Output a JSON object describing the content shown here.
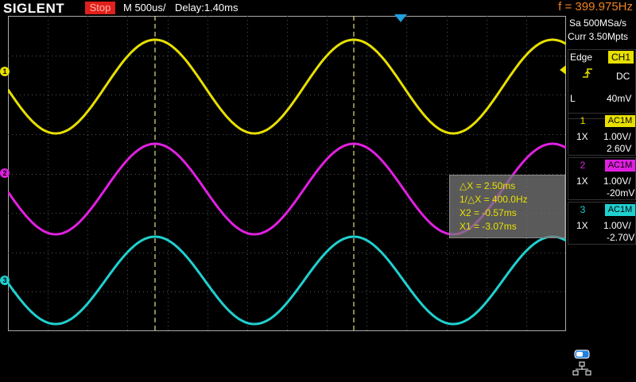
{
  "header": {
    "brand": "SIGLENT",
    "status": "Stop",
    "timebase": "M 500us/",
    "delay": "Delay:1.40ms",
    "frequency": "f = 399.975Hz"
  },
  "acquisition": {
    "sample_rate": "Sa 500MSa/s",
    "memory": "Curr 3.50Mpts"
  },
  "trigger": {
    "type": "Edge",
    "source": "CH1",
    "slope_icon": "rising-edge-icon",
    "coupling": "DC",
    "level_label": "L",
    "level": "40mV"
  },
  "channels": [
    {
      "num": "1",
      "probe": "1X",
      "coupling": "AC1M",
      "scale": "1.00V/",
      "offset": "2.60V",
      "color": "#e8e000"
    },
    {
      "num": "2",
      "probe": "1X",
      "coupling": "AC1M",
      "scale": "1.00V/",
      "offset": "-20mV",
      "color": "#e020e0"
    },
    {
      "num": "3",
      "probe": "1X",
      "coupling": "AC1M",
      "scale": "1.00V/",
      "offset": "-2.70V",
      "color": "#20d0d0"
    }
  ],
  "cursor_measurements": {
    "delta_x": "△X = 2.50ms",
    "inv_delta_x": "1/△X = 400.0Hz",
    "x2": "X2 = -0.57ms",
    "x1": "X1 = -3.07ms"
  },
  "waveform_markers": [
    "1",
    "2",
    "3"
  ],
  "icons": {
    "storage": "usb-storage-icon",
    "network": "network-icon"
  }
}
